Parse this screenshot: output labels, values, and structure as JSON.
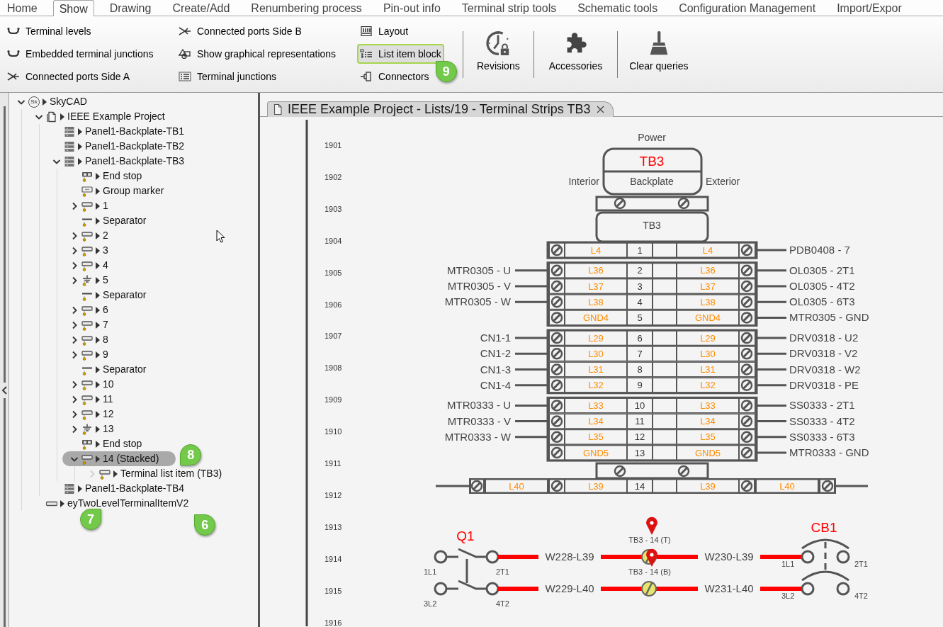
{
  "menu_tabs": [
    {
      "label": "Home",
      "selected": false
    },
    {
      "label": "Show",
      "selected": true
    },
    {
      "label": "Drawing",
      "selected": false
    },
    {
      "label": "Create/Add",
      "selected": false
    },
    {
      "label": "Renumbering process",
      "selected": false
    },
    {
      "label": "Pin-out info",
      "selected": false
    },
    {
      "label": "Terminal strip tools",
      "selected": false
    },
    {
      "label": "Schematic tools",
      "selected": false
    },
    {
      "label": "Configuration Management",
      "selected": false
    },
    {
      "label": "Import/Expor",
      "selected": false
    }
  ],
  "ribbon": {
    "small_buttons": [
      {
        "label": "Terminal levels",
        "kind": "levels",
        "highlighted": false
      },
      {
        "label": "Embedded terminal junctions",
        "kind": "levels",
        "highlighted": false
      },
      {
        "label": "Connected ports Side A",
        "kind": "ports",
        "highlighted": false
      },
      {
        "label": "Connected ports Side B",
        "kind": "ports",
        "highlighted": false
      },
      {
        "label": "Show graphical representations",
        "kind": "graphics",
        "highlighted": false
      },
      {
        "label": "Terminal junctions",
        "kind": "junctions",
        "highlighted": false
      },
      {
        "label": "Layout",
        "kind": "layout",
        "highlighted": false
      },
      {
        "label": "List item block",
        "kind": "list",
        "highlighted": true,
        "callouts": [
          "9"
        ]
      },
      {
        "label": "Connectors",
        "kind": "connector",
        "highlighted": false
      }
    ],
    "large_buttons": [
      {
        "label": "Revisions",
        "kind": "revisions"
      },
      {
        "label": "Accessories",
        "kind": "accessories"
      },
      {
        "label": "Clear queries",
        "kind": "broom"
      }
    ]
  },
  "tree": [
    {
      "label": "SkyCAD",
      "kind": "logo",
      "icon_text": "Sk",
      "expanded": true,
      "selected": false,
      "children": [
        {
          "label": "IEEE Example Project",
          "kind": "project",
          "expanded": true,
          "selected": false,
          "children": [
            {
              "label": "Panel1-Backplate-TB1",
              "kind": "strip",
              "selected": false
            },
            {
              "label": "Panel1-Backplate-TB2",
              "kind": "strip",
              "selected": false
            },
            {
              "label": "Panel1-Backplate-TB3",
              "kind": "strip",
              "expanded": true,
              "selected": false,
              "children": [
                {
                  "label": "End stop",
                  "kind": "end_stop",
                  "selected": false
                },
                {
                  "label": "Group marker",
                  "kind": "group_marker",
                  "selected": false
                },
                {
                  "label": "1",
                  "kind": "terminal",
                  "expanded": false,
                  "selected": false
                },
                {
                  "label": "Separator",
                  "kind": "separator",
                  "selected": false
                },
                {
                  "label": "2",
                  "kind": "terminal",
                  "expanded": false,
                  "selected": false
                },
                {
                  "label": "3",
                  "kind": "terminal",
                  "expanded": false,
                  "selected": false
                },
                {
                  "label": "4",
                  "kind": "terminal",
                  "expanded": false,
                  "selected": false
                },
                {
                  "label": "5",
                  "kind": "ground",
                  "expanded": false,
                  "selected": false
                },
                {
                  "label": "Separator",
                  "kind": "separator",
                  "selected": false
                },
                {
                  "label": "6",
                  "kind": "terminal",
                  "expanded": false,
                  "selected": false
                },
                {
                  "label": "7",
                  "kind": "terminal",
                  "expanded": false,
                  "selected": false
                },
                {
                  "label": "8",
                  "kind": "terminal",
                  "expanded": false,
                  "selected": false
                },
                {
                  "label": "9",
                  "kind": "terminal",
                  "expanded": false,
                  "selected": false
                },
                {
                  "label": "Separator",
                  "kind": "separator",
                  "selected": false
                },
                {
                  "label": "10",
                  "kind": "terminal",
                  "expanded": false,
                  "selected": false
                },
                {
                  "label": "11",
                  "kind": "terminal",
                  "expanded": false,
                  "selected": false
                },
                {
                  "label": "12",
                  "kind": "terminal",
                  "expanded": false,
                  "selected": false
                },
                {
                  "label": "13",
                  "kind": "ground",
                  "expanded": false,
                  "selected": false
                },
                {
                  "label": "End stop",
                  "kind": "end_stop",
                  "selected": false
                },
                {
                  "label": "14 (Stacked)",
                  "kind": "terminal",
                  "expanded": true,
                  "selected": true,
                  "callouts": [
                    "8"
                  ],
                  "children": [
                    {
                      "label": "Terminal list item (TB3)",
                      "kind": "terminal",
                      "expanded": false,
                      "toggle_greyed": true,
                      "selected": false
                    }
                  ]
                }
              ]
            },
            {
              "label": "Panel1-Backplate-TB4",
              "kind": "strip",
              "selected": false
            }
          ]
        },
        {
          "label": "eyTwoLevelTerminalItemV2",
          "kind": "plain_terminal",
          "selected": false,
          "callouts": [
            "7",
            "6"
          ]
        }
      ]
    }
  ],
  "document_tab": {
    "title": "IEEE Example Project - Lists/19 - Terminal Strips TB3"
  },
  "drawing": {
    "row_numbers": [
      "1901",
      "1902",
      "1903",
      "1904",
      "1905",
      "1906",
      "1907",
      "1908",
      "1909",
      "1910",
      "1911",
      "1912",
      "1913",
      "1914",
      "1915",
      "1916"
    ],
    "group_marker": {
      "top_label": "Power",
      "name": "TB3",
      "location": "Backplate",
      "left_side": "Interior",
      "right_side": "Exterior",
      "strip_label": "TB3"
    },
    "terminal_groups": [
      {
        "terminals": [
          {
            "number": "1",
            "left_wire": "L4",
            "right_wire": "L4",
            "right_target": "PDB0408 - 7"
          }
        ]
      },
      {
        "terminals": [
          {
            "number": "2",
            "left_target": "MTR0305 - U",
            "left_wire": "L36",
            "right_wire": "L36",
            "right_target": "OL0305 - 2T1"
          },
          {
            "number": "3",
            "left_target": "MTR0305 - V",
            "left_wire": "L37",
            "right_wire": "L37",
            "right_target": "OL0305 - 4T2"
          },
          {
            "number": "4",
            "left_target": "MTR0305 - W",
            "left_wire": "L38",
            "right_wire": "L38",
            "right_target": "OL0305 - 6T3"
          },
          {
            "number": "5",
            "left_wire": "GND4",
            "right_wire": "GND4",
            "right_target": "MTR0305 - GND"
          }
        ]
      },
      {
        "terminals": [
          {
            "number": "6",
            "left_target": "CN1-1",
            "left_wire": "L29",
            "right_wire": "L29",
            "right_target": "DRV0318 - U2"
          },
          {
            "number": "7",
            "left_target": "CN1-2",
            "left_wire": "L30",
            "right_wire": "L30",
            "right_target": "DRV0318 - V2"
          },
          {
            "number": "8",
            "left_target": "CN1-3",
            "left_wire": "L31",
            "right_wire": "L31",
            "right_target": "DRV0318 - W2"
          },
          {
            "number": "9",
            "left_target": "CN1-4",
            "left_wire": "L32",
            "right_wire": "L32",
            "right_target": "DRV0318 - PE"
          }
        ]
      },
      {
        "terminals": [
          {
            "number": "10",
            "left_target": "MTR0333 - U",
            "left_wire": "L33",
            "right_wire": "L33",
            "right_target": "SS0333 - 2T1"
          },
          {
            "number": "11",
            "left_target": "MTR0333 - V",
            "left_wire": "L34",
            "right_wire": "L34",
            "right_target": "SS0333 - 4T2"
          },
          {
            "number": "12",
            "left_target": "MTR0333 - W",
            "left_wire": "L35",
            "right_wire": "L35",
            "right_target": "SS0333 - 6T3"
          },
          {
            "number": "13",
            "left_wire": "GND5",
            "right_wire": "GND5",
            "right_target": "MTR0333 - GND"
          }
        ]
      }
    ],
    "stacked_terminal": {
      "number": "14",
      "left_wire": "L39",
      "right_wire": "L39",
      "outer_left_wire": "L40",
      "outer_right_wire": "L40"
    }
  },
  "schematic": {
    "switch": {
      "name": "Q1",
      "terminals": [
        "1L1",
        "2T1",
        "3L2",
        "4T2"
      ]
    },
    "circuits": [
      {
        "left_wire": "W228-L39",
        "marker": "TB3 - 14 (T)",
        "right_wire": "W230-L39"
      },
      {
        "left_wire": "W229-L40",
        "marker": "TB3 - 14 (B)",
        "right_wire": "W231-L40"
      }
    ],
    "breaker": {
      "name": "CB1",
      "terminals": [
        "1L1",
        "2T1",
        "3L2",
        "4T2"
      ]
    }
  }
}
